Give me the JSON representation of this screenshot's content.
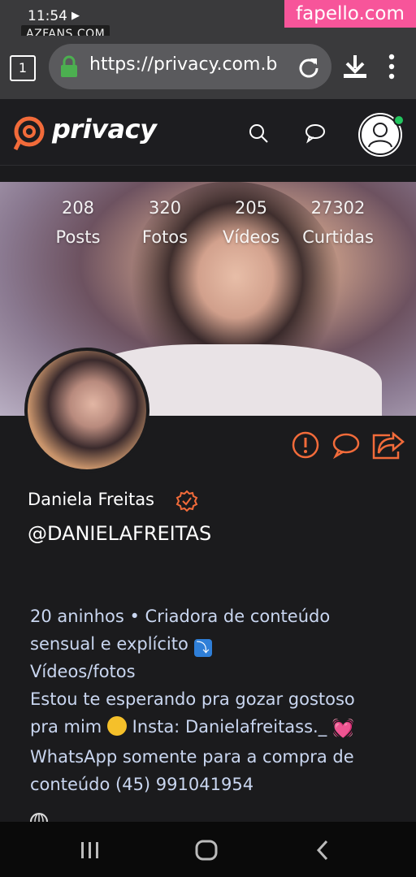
{
  "status_bar": {
    "time": "11:54"
  },
  "watermarks": {
    "site_left": "AZFANS.COM",
    "site_right": "fapello.com"
  },
  "browser": {
    "tab_count": "1",
    "url": "https://privacy.com.b"
  },
  "site": {
    "brand": "privacy",
    "accent_color": "#f26b3a"
  },
  "profile": {
    "stats": [
      {
        "value": "208",
        "label": "Posts"
      },
      {
        "value": "320",
        "label": "Fotos"
      },
      {
        "value": "205",
        "label": "Vídeos"
      },
      {
        "value": "27302",
        "label": "Curtidas"
      }
    ],
    "name": "Daniela Freitas",
    "handle": "@DANIELAFREITAS",
    "bio": {
      "line1": "20 aninhos • Criadora de conteúdo",
      "line2": "sensual e explícito",
      "line2_emoji": "⤵",
      "line3": "Vídeos/fotos",
      "line4": "Estou te esperando pra gozar gostoso",
      "line5_a": "pra mim",
      "line5_b": "Insta: Danielafreitass._",
      "line5_heart": "💓",
      "line6": "WhatsApp somente para a compra de",
      "line7": "conteúdo (45) 991041954"
    }
  },
  "icons": [
    "lock-icon",
    "reload-icon",
    "download-icon",
    "more-icon",
    "search-icon",
    "chat-icon",
    "user-avatar-icon",
    "alert-icon",
    "message-icon",
    "share-icon",
    "verified-icon",
    "globe-icon",
    "recents-icon",
    "home-icon",
    "back-icon"
  ]
}
